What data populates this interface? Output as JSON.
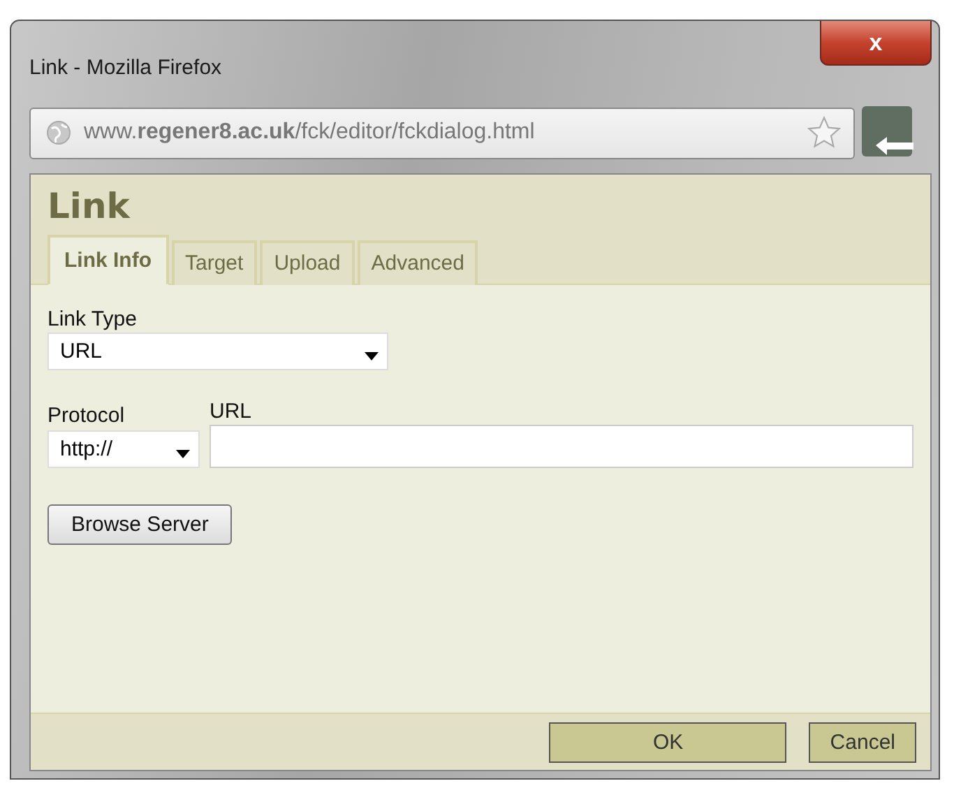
{
  "window": {
    "title": "Link - Mozilla Firefox",
    "close": "x"
  },
  "address_bar": {
    "url": "www.**regener8.ac.uk**/fck/editor/fckdialog.html"
  },
  "dialog": {
    "title": "Link",
    "tabs": [
      {
        "label": "Link Info",
        "selected": true
      },
      {
        "label": "Target",
        "selected": false
      },
      {
        "label": "Upload",
        "selected": false
      },
      {
        "label": "Advanced",
        "selected": false
      }
    ],
    "link_type": {
      "label": "Link Type",
      "value": "URL"
    },
    "protocol": {
      "label": "Protocol",
      "value": "http://"
    },
    "url": {
      "label": "URL"
    },
    "browse_button": "Browse Server",
    "buttons": [
      "OK",
      "Cancel"
    ]
  }
}
